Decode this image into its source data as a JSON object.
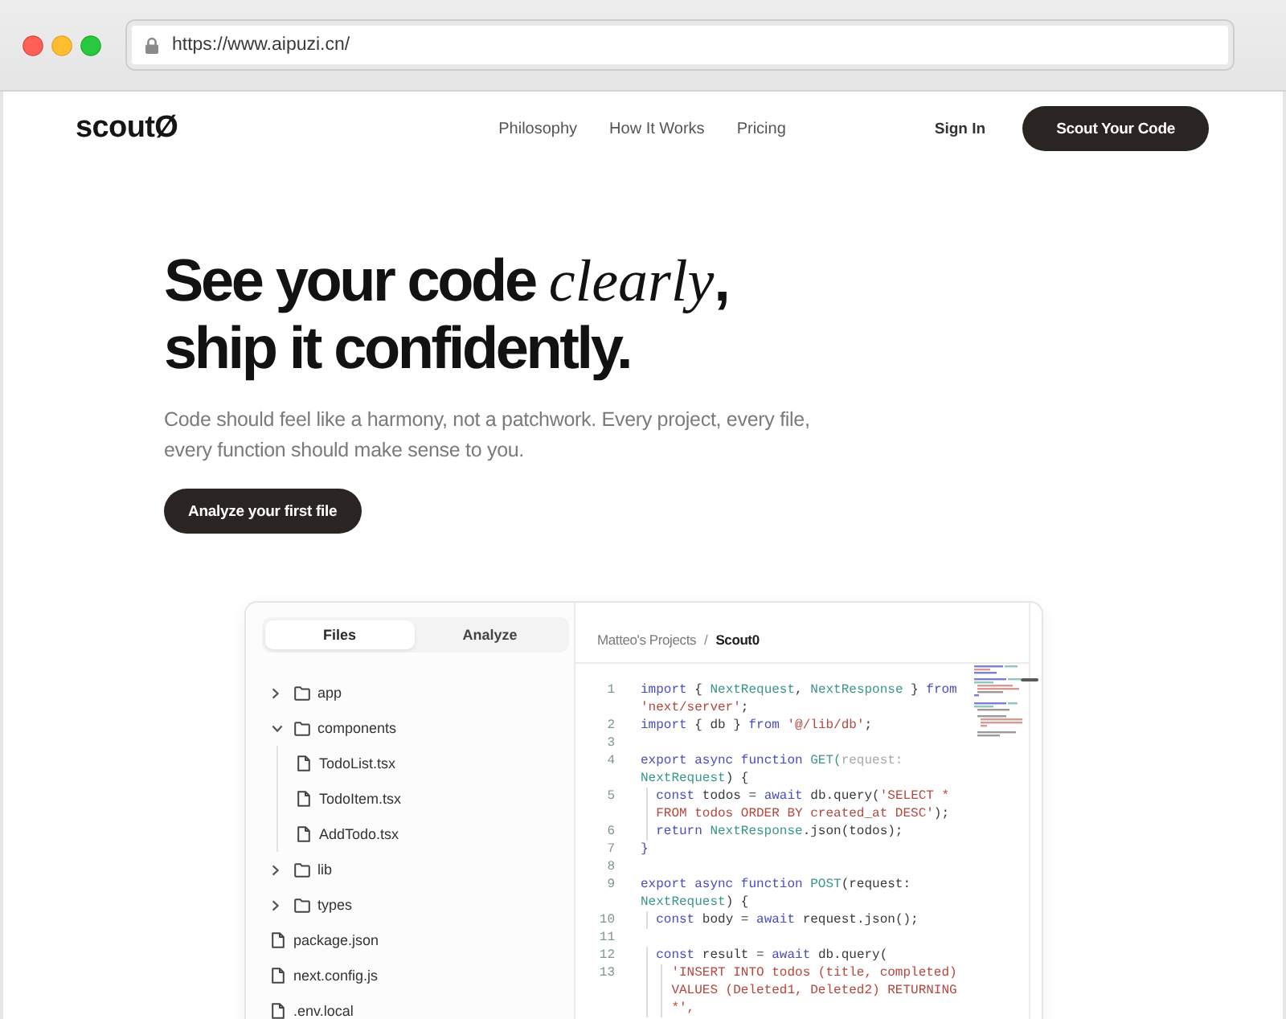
{
  "browser": {
    "url": "https://www.aipuzi.cn/"
  },
  "nav": {
    "logo": "scoutØ",
    "links": [
      "Philosophy",
      "How It Works",
      "Pricing"
    ],
    "sign_in": "Sign In",
    "cta": "Scout Your Code"
  },
  "hero": {
    "title": [
      "See your code *clearly*,",
      "ship it confidently."
    ],
    "subtitle": "Code should feel like a harmony, not a patchwork. Every project, every file, every function should make sense to you.",
    "button": "Analyze your first file"
  },
  "editor": {
    "tabs": [
      {
        "label": "Files",
        "selected": true
      },
      {
        "label": "Analyze",
        "selected": false
      }
    ],
    "tree": [
      {
        "kind": "folder",
        "name": "app",
        "expanded": false
      },
      {
        "kind": "folder",
        "name": "components",
        "expanded": true,
        "children": [
          {
            "kind": "file",
            "name": "TodoList.tsx"
          },
          {
            "kind": "file",
            "name": "TodoItem.tsx"
          },
          {
            "kind": "file",
            "name": "AddTodo.tsx"
          }
        ]
      },
      {
        "kind": "folder",
        "name": "lib",
        "expanded": false
      },
      {
        "kind": "folder",
        "name": "types",
        "expanded": false
      },
      {
        "kind": "file",
        "name": "package.json"
      },
      {
        "kind": "file",
        "name": "next.config.js"
      },
      {
        "kind": "file",
        "name": ".env.local"
      }
    ],
    "breadcrumb": {
      "items": [
        "Matteo's Projects",
        "Scout0"
      ],
      "separator": "/"
    },
    "code": [
      {
        "number": "1",
        "tokens": [
          {
            "kind": "keyword",
            "text": "import"
          },
          {
            "kind": "plain",
            "text": " { "
          },
          {
            "kind": "type",
            "text": "NextRequest"
          },
          {
            "kind": "plain",
            "text": ", "
          },
          {
            "kind": "type",
            "text": "NextResponse"
          },
          {
            "kind": "plain",
            "text": " } "
          },
          {
            "kind": "keyword",
            "text": "from"
          }
        ]
      },
      {
        "tokens": [
          {
            "kind": "string",
            "text": "'next/server'"
          },
          {
            "kind": "plain",
            "text": ";"
          }
        ]
      },
      {
        "number": "2",
        "tokens": [
          {
            "kind": "keyword",
            "text": "import"
          },
          {
            "kind": "plain",
            "text": " { db } "
          },
          {
            "kind": "keyword",
            "text": "from "
          },
          {
            "kind": "string",
            "text": "'@/lib/db'"
          },
          {
            "kind": "plain",
            "text": ";"
          }
        ]
      },
      {
        "number": "3"
      },
      {
        "number": "4",
        "tokens": [
          {
            "kind": "keyword",
            "text": "export async function "
          },
          {
            "kind": "type",
            "text": "GET("
          },
          {
            "kind": "muted",
            "text": "request:"
          }
        ]
      },
      {
        "tokens": [
          {
            "kind": "type",
            "text": "NextRequest"
          },
          {
            "kind": "plain",
            "text": ") {"
          }
        ]
      },
      {
        "number": "5",
        "tokens": [
          {
            "kind": "keyword",
            "text": "  const"
          },
          {
            "kind": "plain",
            "text": " todos = "
          },
          {
            "kind": "keyword",
            "text": "await"
          },
          {
            "kind": "plain",
            "text": " db.query("
          },
          {
            "kind": "string",
            "text": "'SELECT *"
          }
        ]
      },
      {
        "tokens": [
          {
            "kind": "string",
            "text": "  FROM todos ORDER BY created_at DESC'"
          },
          {
            "kind": "plain",
            "text": ");"
          }
        ]
      },
      {
        "number": "6",
        "tokens": [
          {
            "kind": "keyword",
            "text": "  return "
          },
          {
            "kind": "type",
            "text": "NextResponse"
          },
          {
            "kind": "plain",
            "text": ".json(todos);"
          }
        ]
      },
      {
        "number": "7",
        "tokens": [
          {
            "kind": "keyword",
            "text": "}"
          }
        ]
      },
      {
        "number": "8"
      },
      {
        "number": "9",
        "tokens": [
          {
            "kind": "keyword",
            "text": "export async function "
          },
          {
            "kind": "type",
            "text": "POST"
          },
          {
            "kind": "plain",
            "text": "(request:"
          }
        ]
      },
      {
        "tokens": [
          {
            "kind": "type",
            "text": "NextRequest"
          },
          {
            "kind": "plain",
            "text": ") {"
          }
        ]
      },
      {
        "number": "10",
        "tokens": [
          {
            "kind": "keyword",
            "text": "  const"
          },
          {
            "kind": "plain",
            "text": " body = "
          },
          {
            "kind": "keyword",
            "text": "await"
          },
          {
            "kind": "plain",
            "text": " request.json();"
          }
        ]
      },
      {
        "number": "11"
      },
      {
        "number": "12",
        "tokens": [
          {
            "kind": "keyword",
            "text": "  const"
          },
          {
            "kind": "plain",
            "text": " result = "
          },
          {
            "kind": "keyword",
            "text": "await"
          },
          {
            "kind": "plain",
            "text": " db.query("
          }
        ]
      },
      {
        "number": "13",
        "tokens": [
          {
            "kind": "string",
            "text": "    'INSERT INTO todos (title, completed)"
          }
        ]
      },
      {
        "tokens": [
          {
            "kind": "string",
            "text": "    VALUES (Deleted1, Deleted2) RETURNING"
          }
        ]
      },
      {
        "tokens": [
          {
            "kind": "string",
            "text": "    *',"
          }
        ]
      }
    ]
  }
}
